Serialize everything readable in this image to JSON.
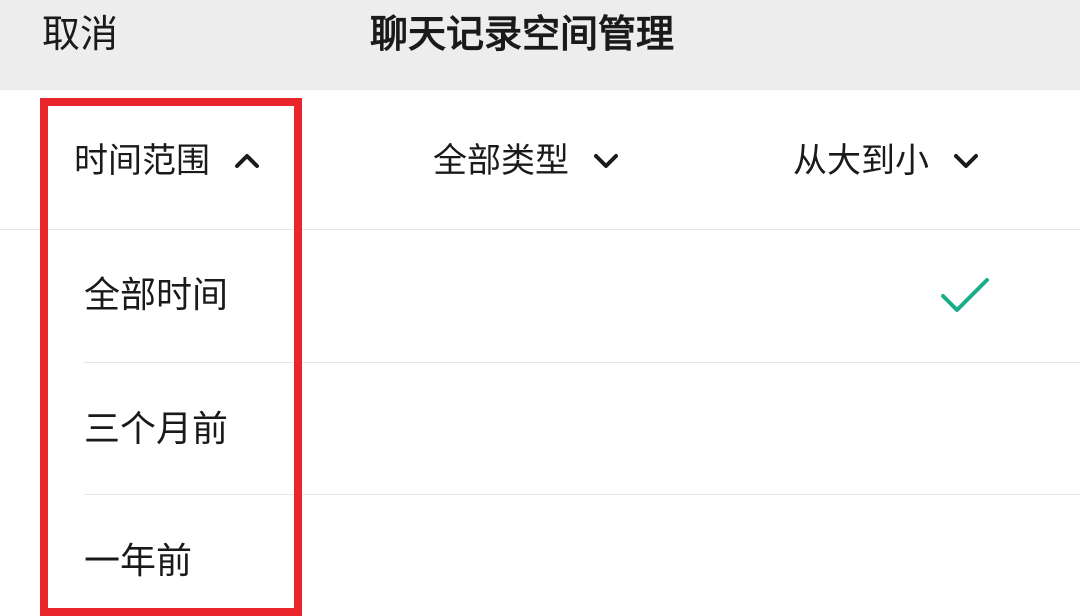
{
  "header": {
    "cancel_label": "取消",
    "title": "聊天记录空间管理"
  },
  "filters": {
    "time_range": {
      "label": "时间范围",
      "state": "expanded"
    },
    "type": {
      "label": "全部类型",
      "state": "collapsed"
    },
    "sort": {
      "label": "从大到小",
      "state": "collapsed"
    }
  },
  "time_options": [
    {
      "label": "全部时间",
      "selected": true
    },
    {
      "label": "三个月前",
      "selected": false
    },
    {
      "label": "一年前",
      "selected": false
    }
  ],
  "colors": {
    "header_bg": "#ededed",
    "check_green": "#1aad8a",
    "highlight_red": "#e8262c"
  },
  "icons": {
    "expanded": "chevron-up-icon",
    "collapsed": "chevron-down-icon",
    "selected": "checkmark-icon"
  }
}
